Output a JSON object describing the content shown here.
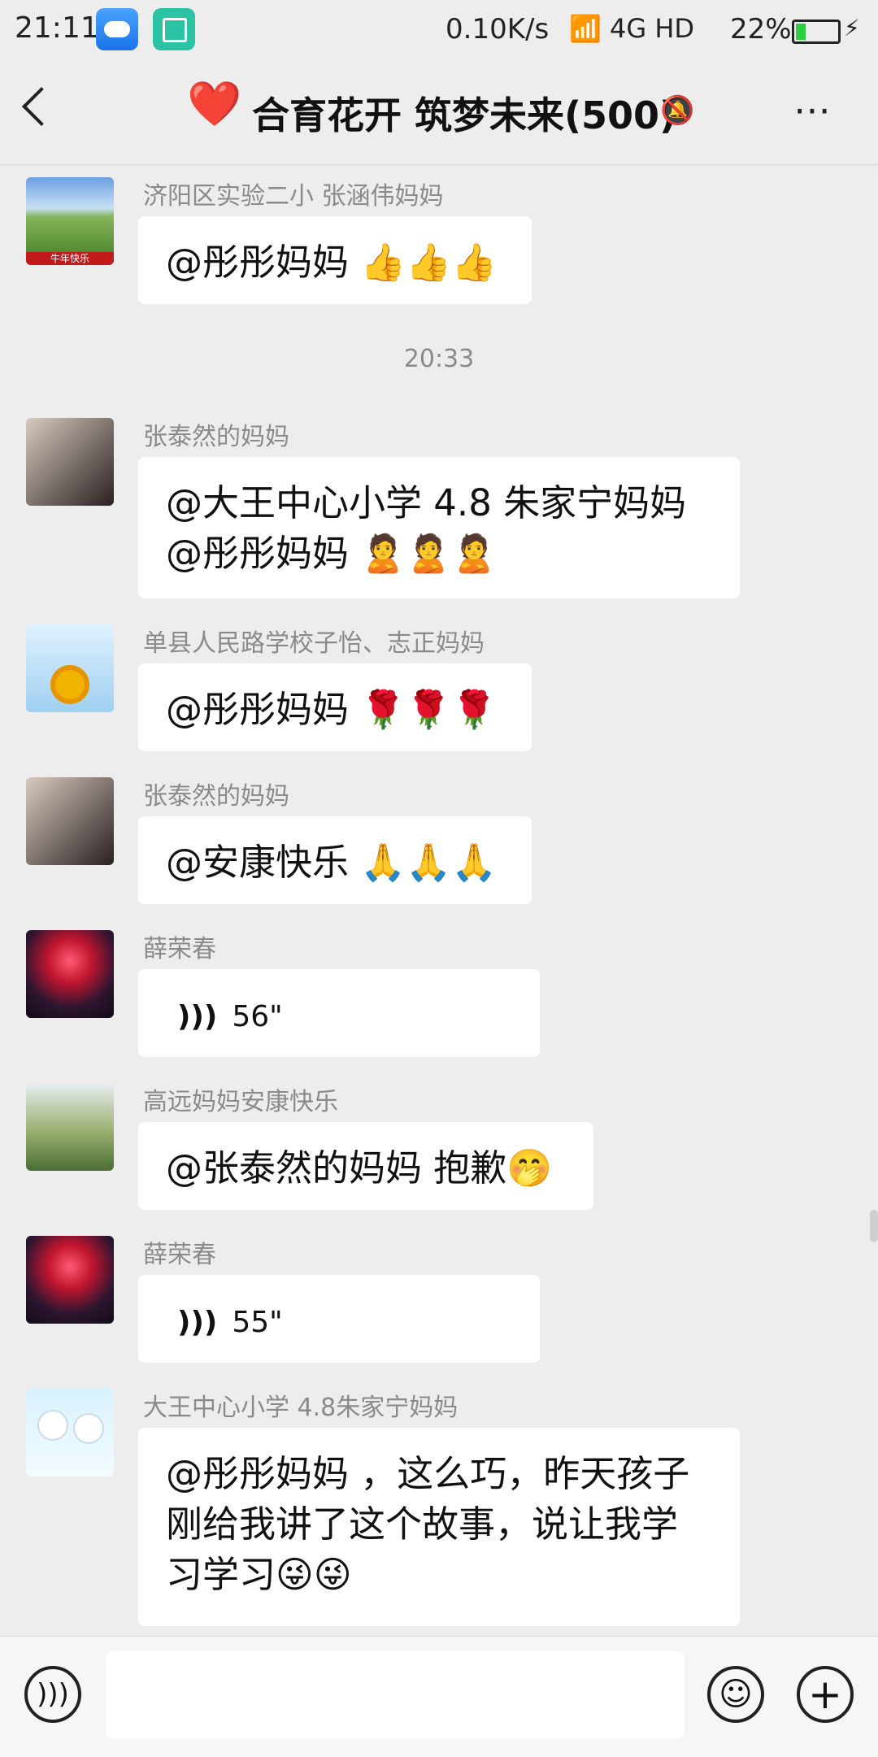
{
  "status_bar": {
    "time": "21:11",
    "network_speed": "0.10K/s",
    "signal": "4G",
    "hd": "HD",
    "battery_percent": "22%",
    "battery_level": 0.22
  },
  "header": {
    "emoji": "❤️",
    "title": "合育花开 筑梦未来(500)",
    "mute_icon": "bell-off-icon",
    "more_icon": "more-dots-icon"
  },
  "messages": [
    {
      "name": "济阳区实验二小    张涵伟妈妈",
      "text": "@彤彤妈妈 👍👍👍"
    },
    {
      "time": "20:33"
    },
    {
      "name": "张泰然的妈妈",
      "text": "@大王中心小学 4.8 朱家宁妈妈 @彤彤妈妈 🙎🙎🙎"
    },
    {
      "name": "单县人民路学校子怡、志正妈妈",
      "text": "@彤彤妈妈 🌹🌹🌹"
    },
    {
      "name": "张泰然的妈妈",
      "text": "@安康快乐 🙏🙏🙏"
    },
    {
      "name": "薛荣春",
      "voice_length": "56\""
    },
    {
      "name": "高远妈妈安康快乐",
      "text": "@张泰然的妈妈  抱歉🤭"
    },
    {
      "name": "薛荣春",
      "voice_length": "55\""
    },
    {
      "name": "大王中心小学 4.8朱家宁妈妈",
      "text": "@彤彤妈妈 ，这么巧，昨天孩子刚给我讲了这个故事，说让我学习学习😜😜"
    }
  ],
  "bottom_bar": {
    "voice_icon": "voice-icon",
    "emoji_icon": "emoji-icon",
    "plus_icon": "plus-icon",
    "input_value": ""
  }
}
